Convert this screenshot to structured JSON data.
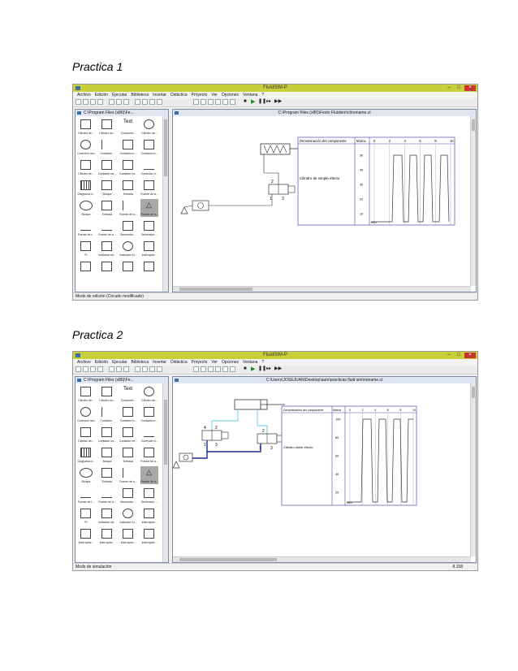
{
  "headings": [
    "Practica 1",
    "Practica 2"
  ],
  "app": {
    "title": "FluidSIM-P",
    "menu": [
      "Archivo",
      "Edición",
      "Ejecutar",
      "Biblioteca",
      "Insertar",
      "Didáctica",
      "Proyecto",
      "Ver",
      "Opciones",
      "Ventana",
      "?"
    ]
  },
  "screens": [
    {
      "library_title": "C:\\Program Files (x86)\\Fe...",
      "circuit_title": "C:\\Program Files (x86)\\Festo Fluidsim\\ct\\noname.ct",
      "status": "Modo de edición (Circuito modificado)",
      "status_right": "",
      "library_labels": [
        "Cilindro de...",
        "Cilindro do...",
        "Compuert...",
        "Cilindro de...",
        "Conexión neu...",
        "Contador...",
        "Contacto m...",
        "Contacto m...",
        "Cilindro de...",
        "Contador ne...",
        "Contador ne...",
        "Conexión d...",
        "Diagrama d...",
        "Bloque",
        "Entrada",
        "Fuente de a...",
        "Fuente de a...",
        "Fuente de t...",
        "Generador ...",
        "Generador ...",
        "Pr",
        "Indicador de...",
        "Indicador lu...",
        "Interruptor..."
      ],
      "diagram": {
        "header": {
          "component": "Denominación del componente",
          "mark": "Marca",
          "ticks": [
            "0",
            "2",
            "4",
            "6",
            "8",
            "10"
          ]
        },
        "component": "Cilindro de simple efecto",
        "y_labels": [
          "50",
          "40",
          "30",
          "20",
          "10"
        ],
        "unit": "mm",
        "circuit_labels": {
          "port2": "2",
          "port1": "1",
          "port3": "3"
        }
      }
    },
    {
      "library_title": "C:\\Program Files (x86)\\Fe...",
      "circuit_title": "C:\\Users\\JOSEJUAN\\Desktop\\auto\\practicas fluid sim\\noname.ct",
      "status": "Modo de simulación",
      "status_right": "8.158",
      "library_labels": [
        "Cilindro de...",
        "Cilindro do...",
        "Compuert...",
        "Cilindro de...",
        "Conexión neu...",
        "Contador...",
        "Contacto m...",
        "Contacto m...",
        "Cilindro de...",
        "Contador ne...",
        "Contador ne...",
        "Conexión d...",
        "Diagrama d...",
        "Bloque",
        "Entrada",
        "Fuente de a...",
        "Fuente de a...",
        "Fuente de t...",
        "Generador ...",
        "Generador ...",
        "Pr",
        "Indicador de...",
        "Indicador lu...",
        "Interruptor..."
      ],
      "diagram": {
        "header": {
          "component": "Denominación del componente",
          "mark": "Marca",
          "ticks": [
            "0",
            "2",
            "4",
            "6",
            "8",
            "10"
          ]
        },
        "component": "Cilindro doble efecto",
        "y_labels": [
          "100",
          "80",
          "60",
          "40",
          "20"
        ],
        "unit": "mm",
        "circuit_labels": {
          "port2": "2",
          "port1": "1",
          "port3": "3",
          "port4": "4"
        }
      }
    }
  ]
}
